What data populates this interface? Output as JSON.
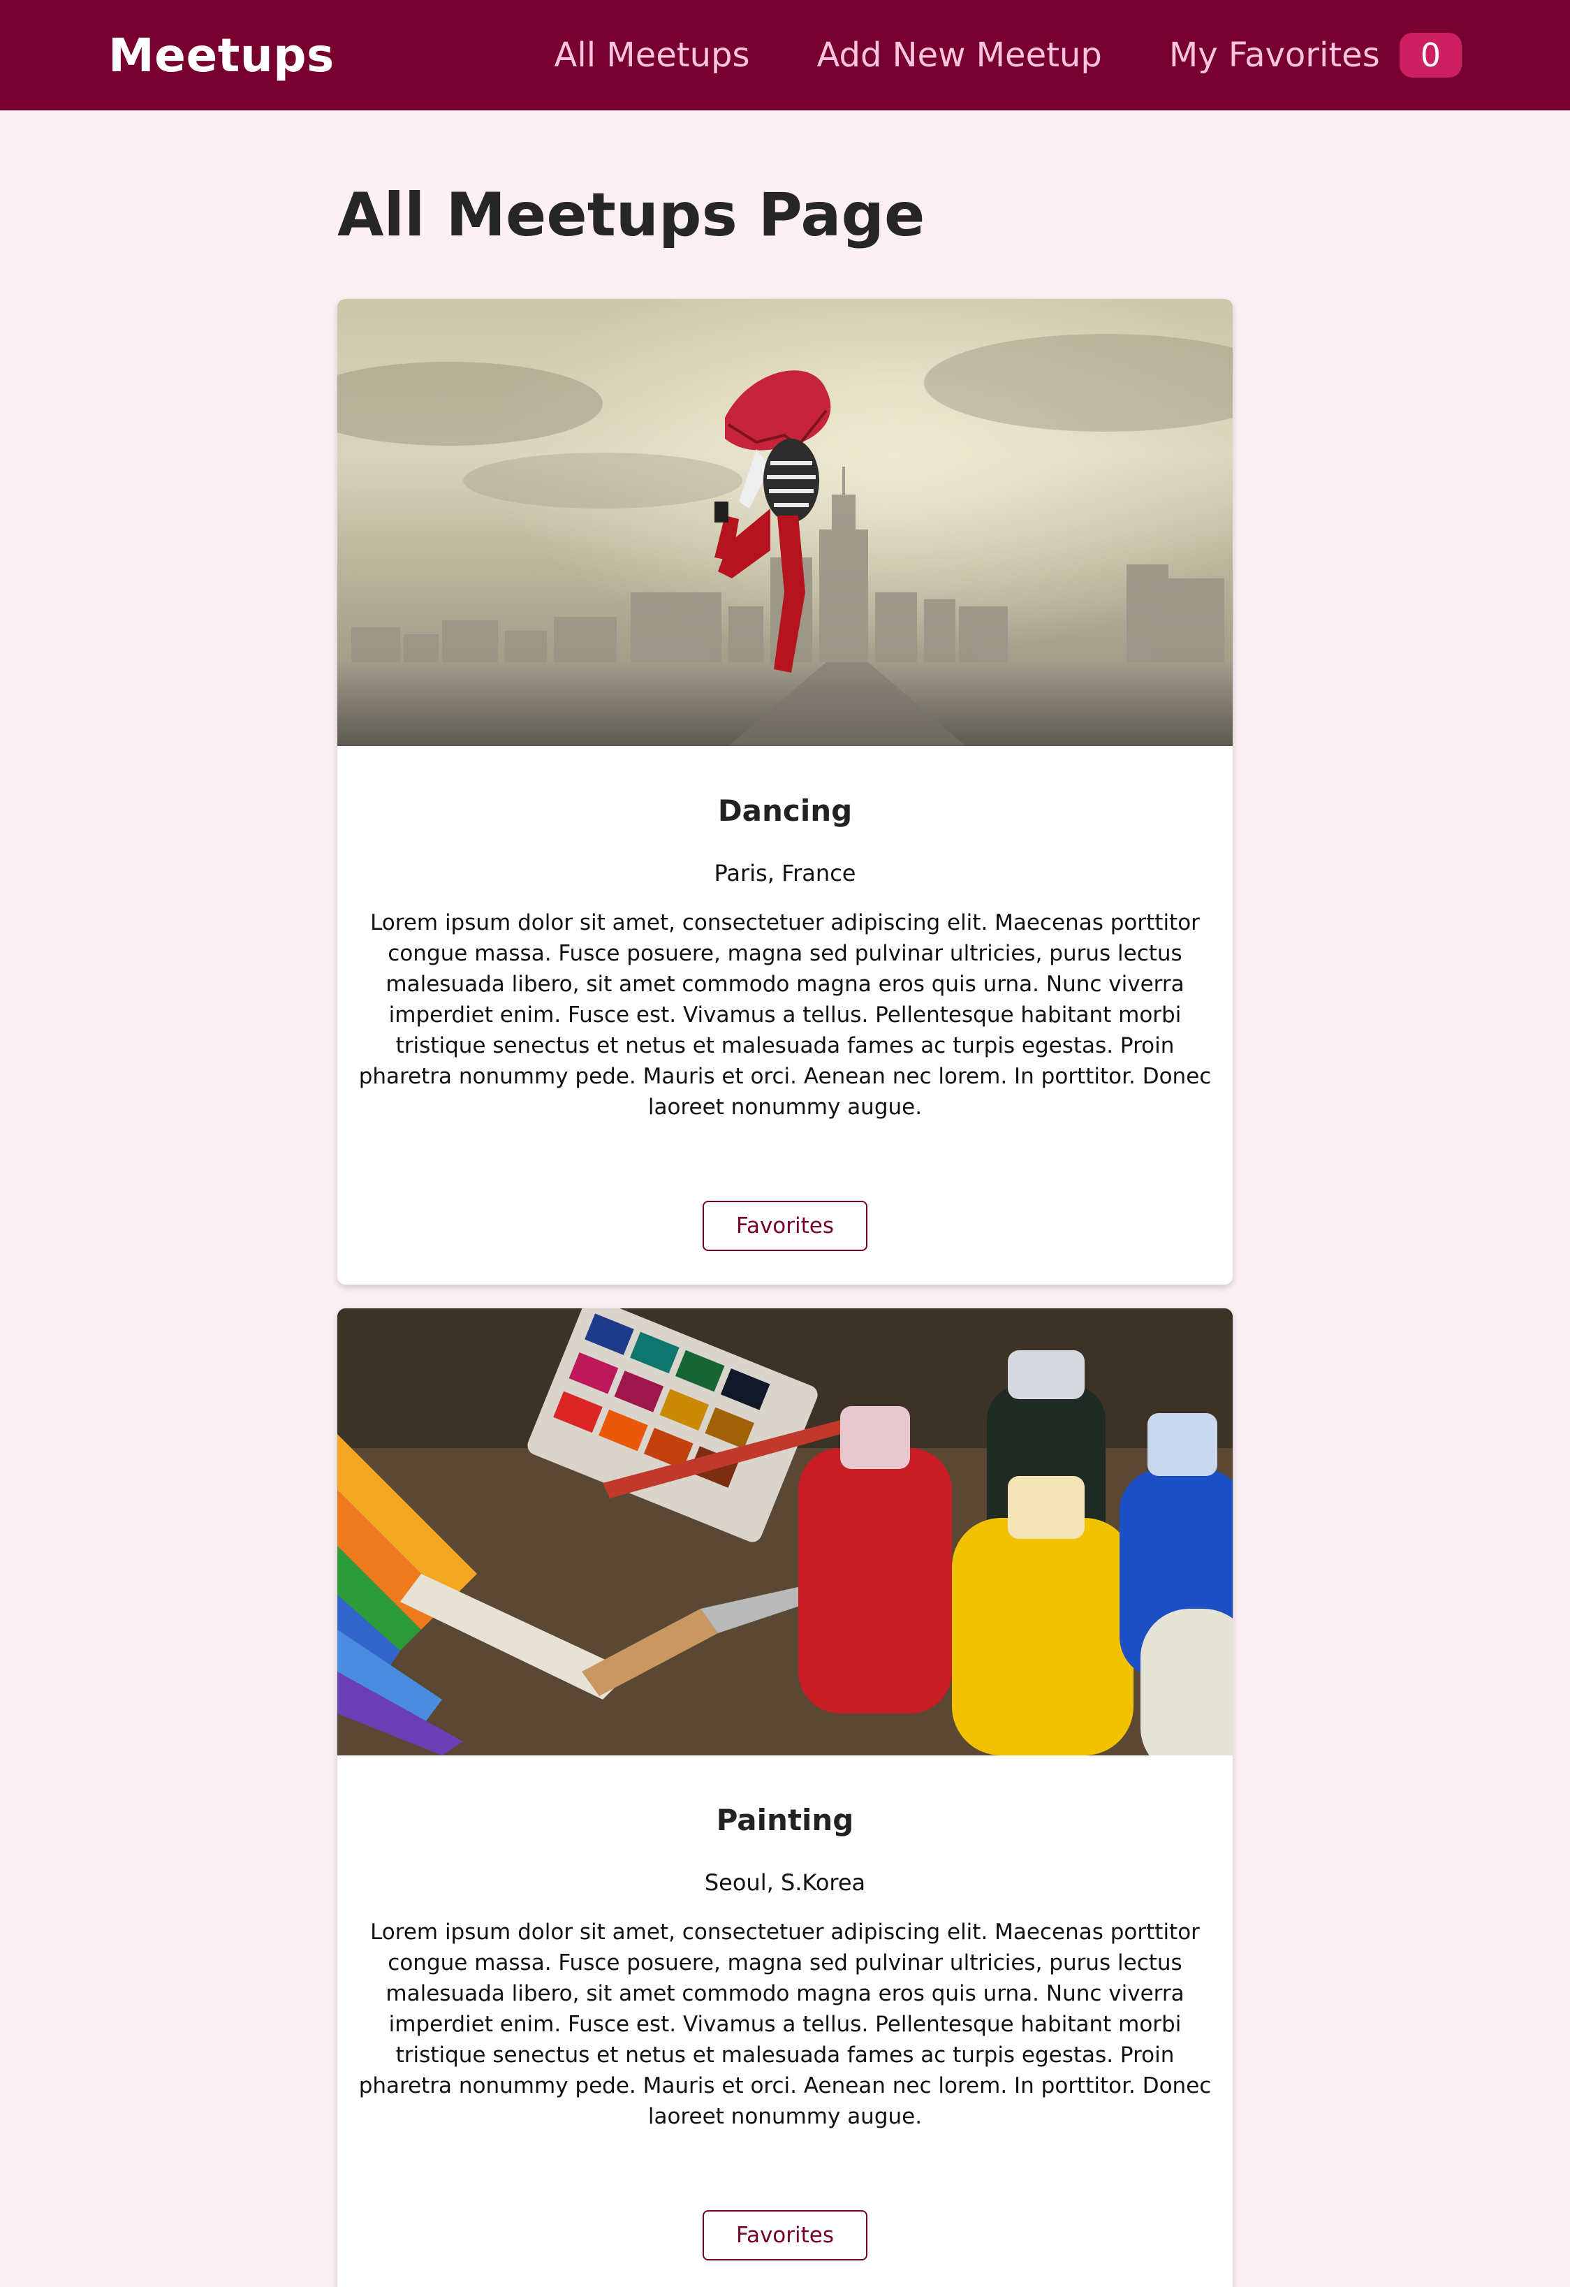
{
  "header": {
    "logo": "Meetups",
    "nav": {
      "all_meetups": "All Meetups",
      "add_new_meetup": "Add New Meetup",
      "my_favorites": "My Favorites",
      "favorites_count": "0"
    }
  },
  "main": {
    "title": "All Meetups Page",
    "meetups": [
      {
        "title": "Dancing",
        "address": "Paris, France",
        "description": "Lorem ipsum dolor sit amet, consectetuer adipiscing elit. Maecenas porttitor congue massa. Fusce posuere, magna sed pulvinar ultricies, purus lectus malesuada libero, sit amet commodo magna eros quis urna. Nunc viverra imperdiet enim. Fusce est. Vivamus a tellus. Pellentesque habitant morbi tristique senectus et netus et malesuada fames ac turpis egestas. Proin pharetra nonummy pede. Mauris et orci. Aenean nec lorem. In porttitor. Donec laoreet nonummy augue.",
        "button": "Favorites"
      },
      {
        "title": "Painting",
        "address": "Seoul, S.Korea",
        "description": "Lorem ipsum dolor sit amet, consectetuer adipiscing elit. Maecenas porttitor congue massa. Fusce posuere, magna sed pulvinar ultricies, purus lectus malesuada libero, sit amet commodo magna eros quis urna. Nunc viverra imperdiet enim. Fusce est. Vivamus a tellus. Pellentesque habitant morbi tristique senectus et netus et malesuada fames ac turpis egestas. Proin pharetra nonummy pede. Mauris et orci. Aenean nec lorem. In porttitor. Donec laoreet nonummy augue.",
        "button": "Favorites"
      }
    ]
  },
  "colors": {
    "header_bg": "#77002e",
    "nav_link": "#fcc4dd",
    "badge_bg": "#cc2062",
    "page_bg": "#fcf0f5",
    "button_border": "#77002e"
  }
}
